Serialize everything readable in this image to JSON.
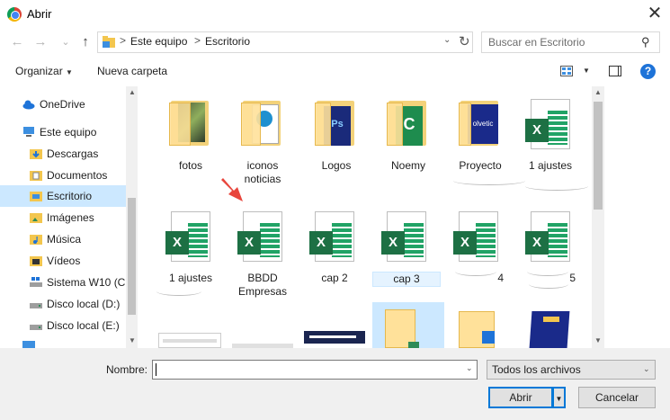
{
  "window": {
    "title": "Abrir",
    "close_glyph": "✕"
  },
  "nav_buttons": {
    "back_glyph": "←",
    "forward_glyph": "→",
    "recent_glyph": "⌄",
    "up_glyph": "↑"
  },
  "address": {
    "crumbs": [
      "Este equipo",
      "Escritorio"
    ],
    "separator": ">",
    "dropdown_glyph": "⌄",
    "refresh_glyph": "↻"
  },
  "search": {
    "placeholder": "Buscar en Escritorio",
    "icon_glyph": "⚲"
  },
  "toolbar": {
    "organize_label": "Organizar",
    "caret": "▼",
    "new_folder_label": "Nueva carpeta",
    "help_glyph": "?"
  },
  "sidebar": {
    "items": [
      {
        "label": "OneDrive",
        "icon": "cloud-icon"
      },
      {
        "label": "Este equipo",
        "icon": "computer-icon"
      },
      {
        "label": "Descargas",
        "icon": "downloads-folder-icon"
      },
      {
        "label": "Documentos",
        "icon": "documents-folder-icon"
      },
      {
        "label": "Escritorio",
        "icon": "desktop-folder-icon",
        "selected": true
      },
      {
        "label": "Imágenes",
        "icon": "pictures-folder-icon"
      },
      {
        "label": "Música",
        "icon": "music-folder-icon"
      },
      {
        "label": "Vídeos",
        "icon": "videos-folder-icon"
      },
      {
        "label": "Sistema W10 (C:",
        "icon": "system-drive-icon"
      },
      {
        "label": "Disco local (D:)",
        "icon": "drive-icon"
      },
      {
        "label": "Disco local (E:)",
        "icon": "drive-icon"
      }
    ],
    "scroll_up": "▲",
    "scroll_down": "▼"
  },
  "files": {
    "row1": [
      {
        "name": "fotos",
        "type": "folder"
      },
      {
        "name": "iconos noticias",
        "type": "folder"
      },
      {
        "name": "Logos",
        "type": "folder"
      },
      {
        "name": "Noemy",
        "type": "folder"
      },
      {
        "name": "Proyecto",
        "type": "folder"
      },
      {
        "name": "1 ajustes",
        "type": "excel"
      }
    ],
    "row2": [
      {
        "name": "1 ajustes",
        "type": "excel"
      },
      {
        "name": "BBDD Empresas",
        "type": "excel"
      },
      {
        "name": "cap 2",
        "type": "excel"
      },
      {
        "name": "cap 3",
        "type": "excel",
        "selected": true
      },
      {
        "name": "4",
        "type": "excel"
      },
      {
        "name": "5",
        "type": "excel"
      }
    ],
    "thumb_texts": {
      "proyecto_brand": "olvetic",
      "excel_letter": "X",
      "ps_letters": "Ps"
    }
  },
  "footer": {
    "filename_label": "Nombre:",
    "filename_value": "",
    "filter_value": "Todos los archivos",
    "open_label": "Abrir",
    "cancel_label": "Cancelar",
    "dropdown_glyph": "⌄"
  },
  "colors": {
    "accent": "#0078d7",
    "selection": "#cce8ff",
    "excel_green": "#1d7044",
    "arrow_red": "#e8453c"
  }
}
